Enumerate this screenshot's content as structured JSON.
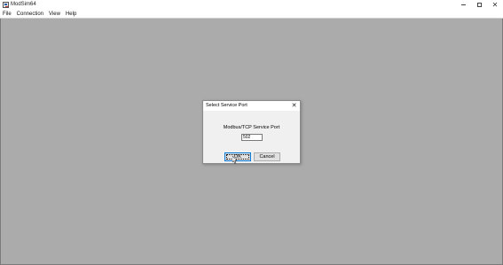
{
  "window": {
    "title": "ModSim64",
    "controls": {
      "minimize": "minimize-icon",
      "maximize": "maximize-icon",
      "close": "close-icon"
    }
  },
  "menu": {
    "items": [
      {
        "label": "File"
      },
      {
        "label": "Connection"
      },
      {
        "label": "View"
      },
      {
        "label": "Help"
      }
    ]
  },
  "dialog": {
    "title": "Select Service Port",
    "close_glyph": "✕",
    "field_label": "Modbus/TCP Service Port",
    "port_value": "502",
    "ok_label": "OK",
    "cancel_label": "Cancel"
  },
  "colors": {
    "workspace": "#ababab",
    "dialog_bg": "#f0f0f0",
    "focus_border": "#0078d7"
  }
}
